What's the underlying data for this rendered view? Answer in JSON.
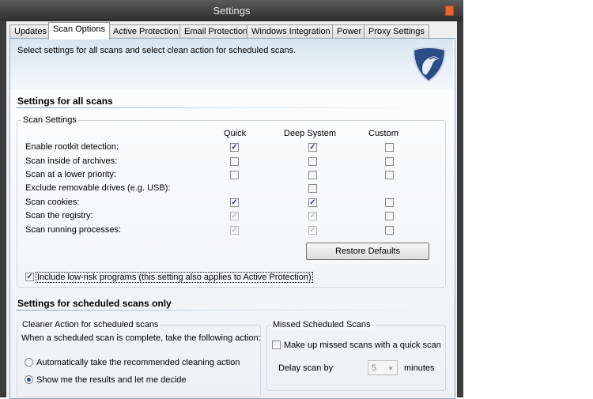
{
  "window": {
    "title": "Settings"
  },
  "tabs": [
    {
      "label": "Updates"
    },
    {
      "label": "Scan Options",
      "selected": true
    },
    {
      "label": "Active Protection"
    },
    {
      "label": "Email Protection"
    },
    {
      "label": "Windows Integration"
    },
    {
      "label": "Power"
    },
    {
      "label": "Proxy Settings"
    }
  ],
  "banner": {
    "text": "Select settings for all scans and select clean action for scheduled scans.",
    "logo_icon": "shield-cobra-logo"
  },
  "all_scans": {
    "heading": "Settings for all scans",
    "group_label": "Scan Settings",
    "columns": [
      "Quick",
      "Deep System",
      "Custom"
    ],
    "rows": [
      {
        "label": "Enable rootkit detection:",
        "states": [
          "checked",
          "checked",
          "unchecked"
        ]
      },
      {
        "label": "Scan inside of archives:",
        "states": [
          "unchecked",
          "unchecked",
          "unchecked"
        ]
      },
      {
        "label": "Scan at a lower priority:",
        "states": [
          "unchecked",
          "unchecked",
          "unchecked"
        ]
      },
      {
        "label": "Exclude removable drives (e.g. USB):",
        "states": [
          null,
          "unchecked",
          null
        ]
      },
      {
        "label": "Scan cookies:",
        "states": [
          "checked",
          "checked",
          "unchecked"
        ]
      },
      {
        "label": "Scan the registry:",
        "states": [
          "checked-disabled",
          "checked-disabled",
          "unchecked"
        ]
      },
      {
        "label": "Scan running processes:",
        "states": [
          "checked-disabled",
          "checked-disabled",
          "unchecked"
        ]
      }
    ],
    "restore_label": "Restore Defaults",
    "low_risk": {
      "label": "Include low-risk programs (this setting also applies to Active Protection)",
      "checked": true
    }
  },
  "scheduled": {
    "heading": "Settings for scheduled scans only",
    "cleaner": {
      "group_label": "Cleaner Action for scheduled scans",
      "desc": "When a scheduled scan is complete, take the following action:",
      "options": [
        {
          "label": "Automatically take the recommended cleaning action",
          "selected": false
        },
        {
          "label": "Show me the results and let me decide",
          "selected": true
        }
      ]
    },
    "missed": {
      "group_label": "Missed Scheduled Scans",
      "makeup_label": "Make up missed scans with a quick scan",
      "makeup_checked": false,
      "delay_label": "Delay scan by",
      "delay_value": "5",
      "delay_unit": "minutes"
    }
  }
}
